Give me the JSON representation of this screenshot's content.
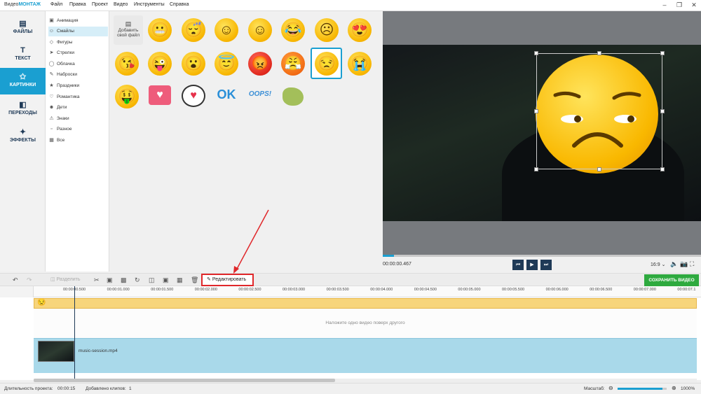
{
  "app": {
    "brand_prefix": "Видео",
    "brand_suffix": "МОНТАЖ"
  },
  "menu": [
    "Файл",
    "Правка",
    "Проект",
    "Видео",
    "Инструменты",
    "Справка"
  ],
  "leftnav": [
    {
      "label": "ФАЙЛЫ",
      "icon": "image-icon"
    },
    {
      "label": "ТЕКСТ",
      "icon": "text-icon"
    },
    {
      "label": "КАРТИНКИ",
      "icon": "star-icon",
      "active": true
    },
    {
      "label": "ПЕРЕХОДЫ",
      "icon": "transitions-icon"
    },
    {
      "label": "ЭФФЕКТЫ",
      "icon": "wand-icon"
    }
  ],
  "categories": [
    "Анимация",
    "Смайлы",
    "Фигуры",
    "Стрелки",
    "Облачка",
    "Наброски",
    "Праздники",
    "Романтика",
    "Дети",
    "Знаки",
    "Разное",
    "Все"
  ],
  "active_category": "Смайлы",
  "grid": {
    "add_file_label_1": "Добавить",
    "add_file_label_2": "свой файл",
    "ok_sticker": "OK",
    "oops_sticker": "OOPS!"
  },
  "player": {
    "timecode": "00:00:00.467",
    "aspect": "16:9"
  },
  "toolbar": {
    "split": "Разделить",
    "edit": "Редактировать",
    "save": "СОХРАНИТЬ ВИДЕО"
  },
  "ruler": [
    "00:00:00.500",
    "00:00:01.000",
    "00:00:01.500",
    "00:00:02.000",
    "00:00:02.500",
    "00:00:03.000",
    "00:00:03.500",
    "00:00:04.000",
    "00:00:04.500",
    "00:00:05.000",
    "00:00:05.500",
    "00:00:06.000",
    "00:00:06.500",
    "00:00:07.000",
    "00:00:07.1"
  ],
  "timeline": {
    "overlay_hint": "Наложите одно видео поверх другого",
    "clip_name": "music-session.mp4"
  },
  "status": {
    "duration_label": "Длительность проекта:",
    "duration": "00:00:15",
    "clips_label": "Добавлено клипов:",
    "clips": "1",
    "scale_label": "Масштаб:",
    "zoom": "1000%",
    "zoom_level": 0.92
  }
}
